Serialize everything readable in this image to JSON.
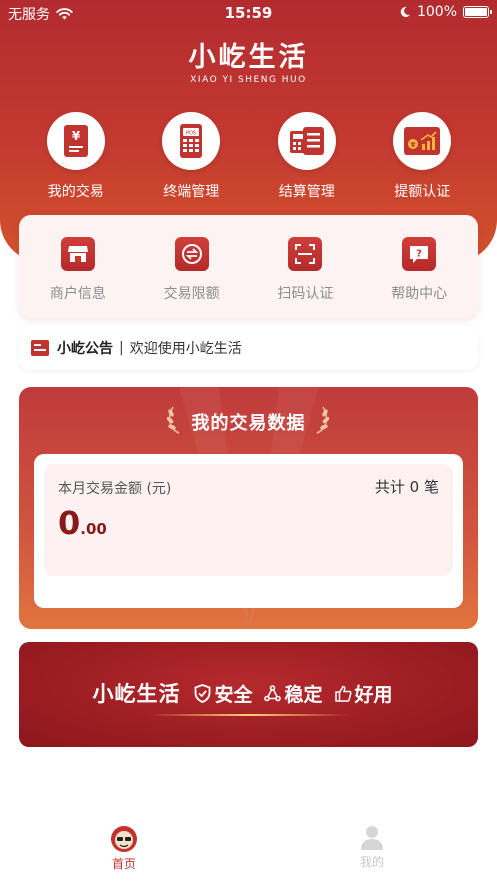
{
  "status_bar": {
    "carrier": "无服务",
    "time": "15:59",
    "battery": "100%"
  },
  "logo": {
    "name": "小屹生活",
    "pinyin": "XIAO YI SHENG HUO"
  },
  "top_menu": [
    {
      "label": "我的交易",
      "icon": "receipt-yen-icon"
    },
    {
      "label": "终端管理",
      "icon": "pos-terminal-icon"
    },
    {
      "label": "结算管理",
      "icon": "settlement-icon"
    },
    {
      "label": "提额认证",
      "icon": "limit-raise-chart-icon"
    }
  ],
  "sub_menu": [
    {
      "label": "商户信息",
      "icon": "storefront-icon"
    },
    {
      "label": "交易限额",
      "icon": "exchange-limit-icon"
    },
    {
      "label": "扫码认证",
      "icon": "scan-icon"
    },
    {
      "label": "帮助中心",
      "icon": "help-question-icon"
    }
  ],
  "notice": {
    "title": "小屹公告",
    "separator": "|",
    "message": "欢迎使用小屹生活"
  },
  "data_card": {
    "title": "我的交易数据",
    "amount_label": "本月交易金额 (元)",
    "count_text": "共计 0 笔",
    "amount_integer": "0",
    "amount_decimal": ".00"
  },
  "banner": {
    "brand": "小屹生活",
    "features": [
      {
        "label": "安全",
        "icon": "shield-check-icon"
      },
      {
        "label": "稳定",
        "icon": "network-nodes-icon"
      },
      {
        "label": "好用",
        "icon": "thumbs-up-icon"
      }
    ]
  },
  "tabbar": [
    {
      "label": "首页",
      "icon": "home-avatar-icon",
      "active": true
    },
    {
      "label": "我的",
      "icon": "user-icon",
      "active": false
    }
  ],
  "colors": {
    "primary": "#c0332f",
    "dark_red": "#8c171c",
    "light_pink": "#fdf3f3"
  }
}
